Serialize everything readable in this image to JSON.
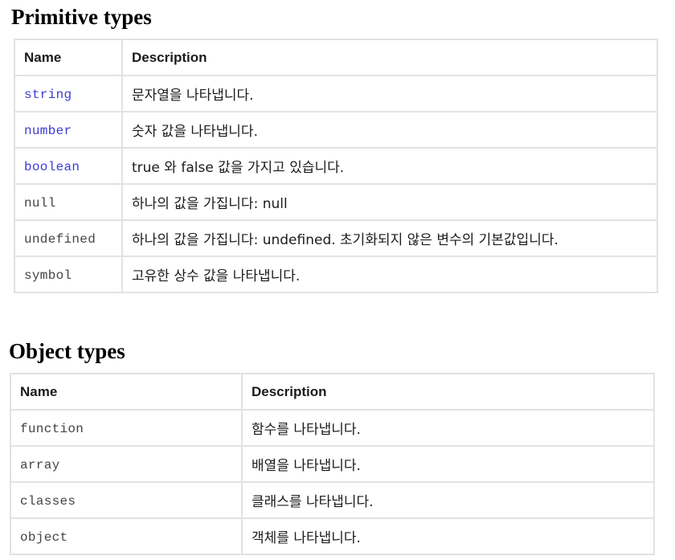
{
  "primitive": {
    "title": "Primitive types",
    "headers": {
      "name": "Name",
      "description": "Description"
    },
    "rows": [
      {
        "name": "string",
        "description": "문자열을 나타냅니다."
      },
      {
        "name": "number",
        "description": "숫자 값을 나타냅니다."
      },
      {
        "name": "boolean",
        "description": "true 와 false 값을 가지고 있습니다."
      },
      {
        "name": "null",
        "description": "하나의 값을 가집니다: null"
      },
      {
        "name": "undefined",
        "description": "하나의 값을 가집니다: undefined. 초기화되지 않은 변수의 기본값입니다."
      },
      {
        "name": "symbol",
        "description": "고유한 상수 값을 나타냅니다."
      }
    ],
    "link_color": "#3b3bd6"
  },
  "object": {
    "title": "Object types",
    "headers": {
      "name": "Name",
      "description": "Description"
    },
    "rows": [
      {
        "name": "function",
        "description": "함수를 나타냅니다."
      },
      {
        "name": "array",
        "description": "배열을 나타냅니다."
      },
      {
        "name": "classes",
        "description": "클래스를 나타냅니다."
      },
      {
        "name": "object",
        "description": "객체를 나타냅니다."
      }
    ]
  }
}
